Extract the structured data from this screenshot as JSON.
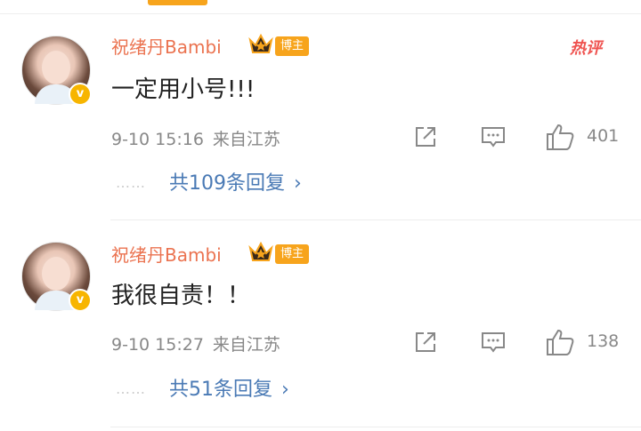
{
  "comments": [
    {
      "username": "祝绪丹Bambi",
      "role_badge": "博主",
      "hot_badge": "热评",
      "content": "一定用小号!!!",
      "time": "9-10 15:16",
      "location": "来自江苏",
      "likes": "401",
      "replies": "共109条回复",
      "verified_mark": "v"
    },
    {
      "username": "祝绪丹Bambi",
      "role_badge": "博主",
      "content": "我很自责！！",
      "time": "9-10 15:27",
      "location": "来自江苏",
      "likes": "138",
      "replies": "共51条回复",
      "verified_mark": "v"
    }
  ],
  "ui": {
    "dots": "……",
    "chevron": "›"
  },
  "colors": {
    "accent": "#f7a41c",
    "username": "#eb7350",
    "link": "#4a7ab5",
    "hot": "#ef5350"
  }
}
